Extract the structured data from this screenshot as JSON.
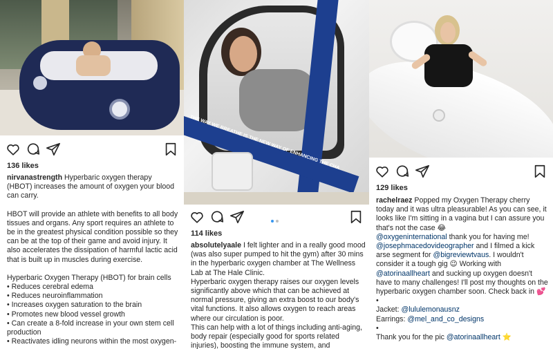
{
  "colors": {
    "text": "#262626",
    "mention": "#003569",
    "dot_active": "#3897f0",
    "chamber_blue": "#1d3f8f"
  },
  "icons": [
    "heart-icon",
    "comment-icon",
    "share-icon",
    "bookmark-icon"
  ],
  "post1": {
    "likes": "136 likes",
    "username": "nirvanastrength",
    "caption_first": "Hyperbaric oxygen therapy (HBOT) increases the amount of oxygen your blood can carry.",
    "paragraph2": "HBOT will provide an athlete with benefits to all body tissues and organs. Any sport requires an athlete to be in the greatest physical condition possible so they can be at the top of their game and avoid injury. It also accelerates the dissipation of harmful lactic acid that is built up in muscles during exercise.",
    "list_heading": "Hyperbaric Oxygen Therapy (HBOT) for brain cells",
    "bullets": [
      "• Reduces cerebral edema",
      "• Reduces neuroinflammation",
      "• Increases oxygen saturation to the brain",
      "• Promotes new blood vessel growth",
      "• Can create a 8-fold increase in your own stem cell production",
      "• Reactivates idling neurons within the most oxygen-"
    ]
  },
  "post2": {
    "likes": "114 likes",
    "username": "absolutelyaale",
    "caption_first": "I felt lighter and in a really good mood (was also super pumped to hit the gym) after 30 mins in the hyperbaric oxygen chamber at The Wellness Lab at The Hale Clinic.",
    "paragraph2": "Hyperbaric oxygen therapy raises our oxygen levels significantly above which that can be achieved at normal pressure, giving an extra boost to our body's vital functions. It also allows oxygen to reach areas where our circulation is poor.",
    "paragraph3": "This can help with a lot of things including anti-aging, body repair (especially good for sports related injuries), boosting the immune system, and",
    "chamber_text": "THE WAY WE BREATHE IS THE NEW WAY OF ENHANCING THE CHA"
  },
  "post3": {
    "likes": "129 likes",
    "username": "rachelraez",
    "caption_first": "Popped my Oxygen Therapy cherry today and it was ultra pleasurable! As you can see, it looks like I'm sitting in a vagina but I can assure you that's not the case 😂",
    "mention1": "@oxygeninternational",
    "line1_rest": " thank you for having me!",
    "mention2": "@josephmacedovideographer",
    "line2_mid": " and I filmed a kick arse segment for ",
    "mention3": "@bigreviewtvaus",
    "line2_rest": ". I wouldn't consider it a tough gig 😉 Working with ",
    "mention4": "@atorinaallheart",
    "line2_end": " and sucking up oxygen doesn't have to many challenges! I'll post my thoughts on the hyperbaric oxygen chamber soon. Check back in 💕",
    "bullet_dot": "•",
    "jacket_label": "Jacket: ",
    "jacket_mention": "@lululemonausnz",
    "earrings_label": "Earrings: ",
    "earrings_mention": "@mel_and_co_designs",
    "thanks_text": "Thank you for the pic ",
    "thanks_mention": "@atorinaallheart",
    "thanks_emoji": " ⭐"
  }
}
